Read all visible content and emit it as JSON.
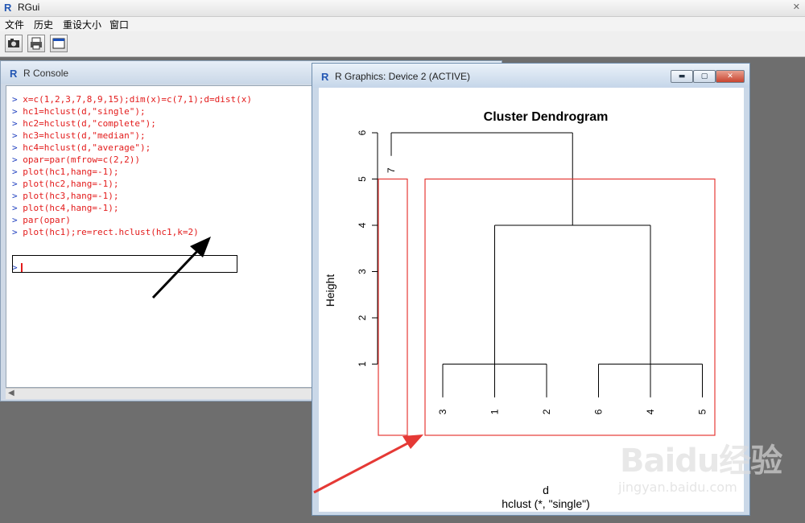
{
  "app": {
    "title": "RGui"
  },
  "menu": {
    "items": [
      "文件",
      "历史",
      "重设大小",
      "窗口"
    ]
  },
  "toolbar": {
    "buttons": [
      "camera-icon",
      "print-icon",
      "window-icon"
    ]
  },
  "console": {
    "title": "R Console",
    "lines": [
      {
        "prompt": ">",
        "code": "x=c(1,2,3,7,8,9,15);dim(x)=c(7,1);d=dist(x)"
      },
      {
        "prompt": ">",
        "code": "hc1=hclust(d,\"single\");"
      },
      {
        "prompt": ">",
        "code": "hc2=hclust(d,\"complete\");"
      },
      {
        "prompt": ">",
        "code": "hc3=hclust(d,\"median\");"
      },
      {
        "prompt": ">",
        "code": "hc4=hclust(d,\"average\");"
      },
      {
        "prompt": ">",
        "code": "opar=par(mfrow=c(2,2))"
      },
      {
        "prompt": ">",
        "code": "plot(hc1,hang=-1);"
      },
      {
        "prompt": ">",
        "code": "plot(hc2,hang=-1);"
      },
      {
        "prompt": ">",
        "code": "plot(hc3,hang=-1);"
      },
      {
        "prompt": ">",
        "code": "plot(hc4,hang=-1);"
      },
      {
        "prompt": ">",
        "code": "par(opar)"
      },
      {
        "prompt": ">",
        "code": "plot(hc1);re=rect.hclust(hc1,k=2)"
      }
    ],
    "current_prompt": ">"
  },
  "graphics": {
    "title": "R Graphics: Device 2 (ACTIVE)",
    "buttons": {
      "minimize": "▬",
      "maximize": "▢",
      "close": "✕"
    }
  },
  "chart_data": {
    "type": "dendrogram",
    "title": "Cluster Dendrogram",
    "ylabel": "Height",
    "xlabel": "d",
    "subtitle": "hclust (*, \"single\")",
    "y_ticks": [
      1,
      2,
      3,
      4,
      5,
      6
    ],
    "ylim": [
      0,
      6
    ],
    "leaf_order": [
      "3",
      "1",
      "2",
      "6",
      "4",
      "5",
      "7"
    ],
    "merges": [
      {
        "members": [
          "3",
          "1",
          "2"
        ],
        "height": 1
      },
      {
        "members": [
          "6",
          "4",
          "5"
        ],
        "height": 1
      },
      {
        "members": [
          "3",
          "1",
          "2",
          "6",
          "4",
          "5"
        ],
        "height": 4
      },
      {
        "members": [
          "7",
          "3",
          "1",
          "2",
          "6",
          "4",
          "5"
        ],
        "height": 6
      }
    ],
    "leaf_7_height": 5.5,
    "rect_clusters": [
      [
        "7"
      ],
      [
        "3",
        "1",
        "2",
        "6",
        "4",
        "5"
      ]
    ],
    "rect_cut_height": 5,
    "rect_color": "#e53935"
  },
  "watermark": {
    "brand": "Baidu经验",
    "url": "jingyan.baidu.com"
  }
}
